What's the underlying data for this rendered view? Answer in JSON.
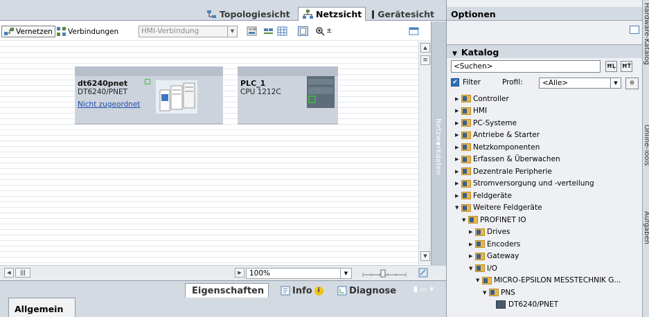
{
  "view_tabs": {
    "topology": "Topologiesicht",
    "network": "Netzsicht",
    "device": "Gerätesicht"
  },
  "toolbar": {
    "network_btn": "Vernetzen",
    "connections_btn": "Verbindungen",
    "connection_type": "HMI-Verbindung"
  },
  "devices": [
    {
      "name": "dt6240pnet",
      "type": "DT6240/PNET",
      "link": "Nicht zugeordnet"
    },
    {
      "name": "PLC_1",
      "type": "CPU 1212C"
    }
  ],
  "side_strip": "Netzwerkdaten",
  "zoom": "100%",
  "inspector": {
    "properties": "Eigenschaften",
    "info": "Info",
    "diagnose": "Diagnose"
  },
  "bottom_tab": "Allgemein",
  "right": {
    "options_title": "Optionen",
    "catalog_title": "Katalog",
    "search_placeholder": "<Suchen>",
    "filter_label": "Filter",
    "profile_label": "Profil:",
    "profile_value": "<Alle>",
    "tree": [
      {
        "label": "Controller",
        "level": 0,
        "expanded": false
      },
      {
        "label": "HMI",
        "level": 0,
        "expanded": false
      },
      {
        "label": "PC-Systeme",
        "level": 0,
        "expanded": false
      },
      {
        "label": "Antriebe & Starter",
        "level": 0,
        "expanded": false
      },
      {
        "label": "Netzkomponenten",
        "level": 0,
        "expanded": false
      },
      {
        "label": "Erfassen & Überwachen",
        "level": 0,
        "expanded": false
      },
      {
        "label": "Dezentrale Peripherie",
        "level": 0,
        "expanded": false
      },
      {
        "label": "Stromversorgung und -verteilung",
        "level": 0,
        "expanded": false
      },
      {
        "label": "Feldgeräte",
        "level": 0,
        "expanded": false
      },
      {
        "label": "Weitere Feldgeräte",
        "level": 0,
        "expanded": true
      },
      {
        "label": "PROFINET IO",
        "level": 1,
        "expanded": true
      },
      {
        "label": "Drives",
        "level": 2,
        "expanded": false
      },
      {
        "label": "Encoders",
        "level": 2,
        "expanded": false
      },
      {
        "label": "Gateway",
        "level": 2,
        "expanded": false
      },
      {
        "label": "I/O",
        "level": 2,
        "expanded": true
      },
      {
        "label": "MICRO-EPSILON MESSTECHNIK G...",
        "level": 3,
        "expanded": true
      },
      {
        "label": "PNS",
        "level": 4,
        "expanded": true
      },
      {
        "label": "DT6240/PNET",
        "level": 5,
        "device": true
      }
    ],
    "strip": {
      "catalog": "Hardware-Katalog",
      "online": "Online-Tools",
      "tasks": "Aufgaben"
    }
  }
}
